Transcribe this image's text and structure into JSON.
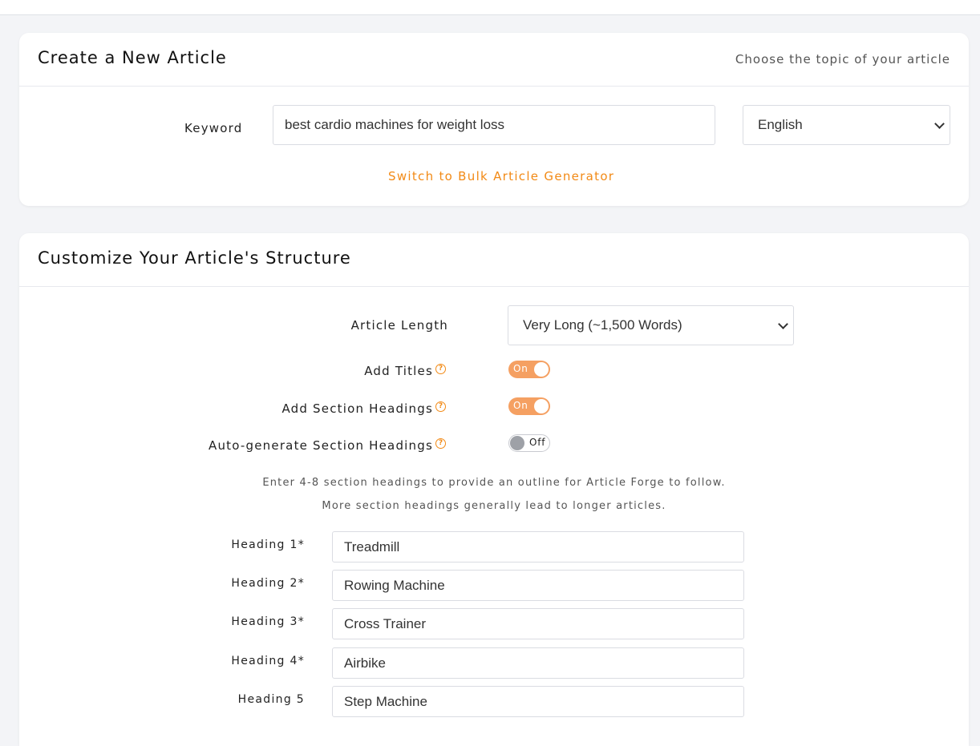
{
  "create_card": {
    "title": "Create a New Article",
    "subtitle": "Choose the topic of your article",
    "keyword_label": "Keyword",
    "keyword_value": "best cardio machines for weight loss",
    "language_value": "English",
    "bulk_link": "Switch to Bulk Article Generator"
  },
  "structure_card": {
    "title": "Customize Your Article's Structure",
    "length_label": "Article Length",
    "length_value": "Very Long (~1,500 Words)",
    "options": [
      {
        "label": "Add Titles",
        "state": "On"
      },
      {
        "label": "Add Section Headings",
        "state": "On"
      },
      {
        "label": "Auto-generate Section Headings",
        "state": "Off"
      }
    ],
    "hint_line1": "Enter 4-8 section headings to provide an outline for Article Forge to follow.",
    "hint_line2": "More section headings generally lead to longer articles.",
    "headings": [
      {
        "label": "Heading 1*",
        "value": "Treadmill"
      },
      {
        "label": "Heading 2*",
        "value": "Rowing Machine"
      },
      {
        "label": "Heading 3*",
        "value": "Cross Trainer"
      },
      {
        "label": "Heading 4*",
        "value": "Airbike"
      },
      {
        "label": "Heading 5",
        "value": "Step Machine"
      }
    ]
  },
  "icons": {
    "help": "question-circle-icon",
    "dropdown": "chevron-down-icon"
  },
  "colors": {
    "accent": "#f28a16",
    "toggle_on": "#f5a062",
    "toggle_off_knob": "#9ea1a7"
  }
}
